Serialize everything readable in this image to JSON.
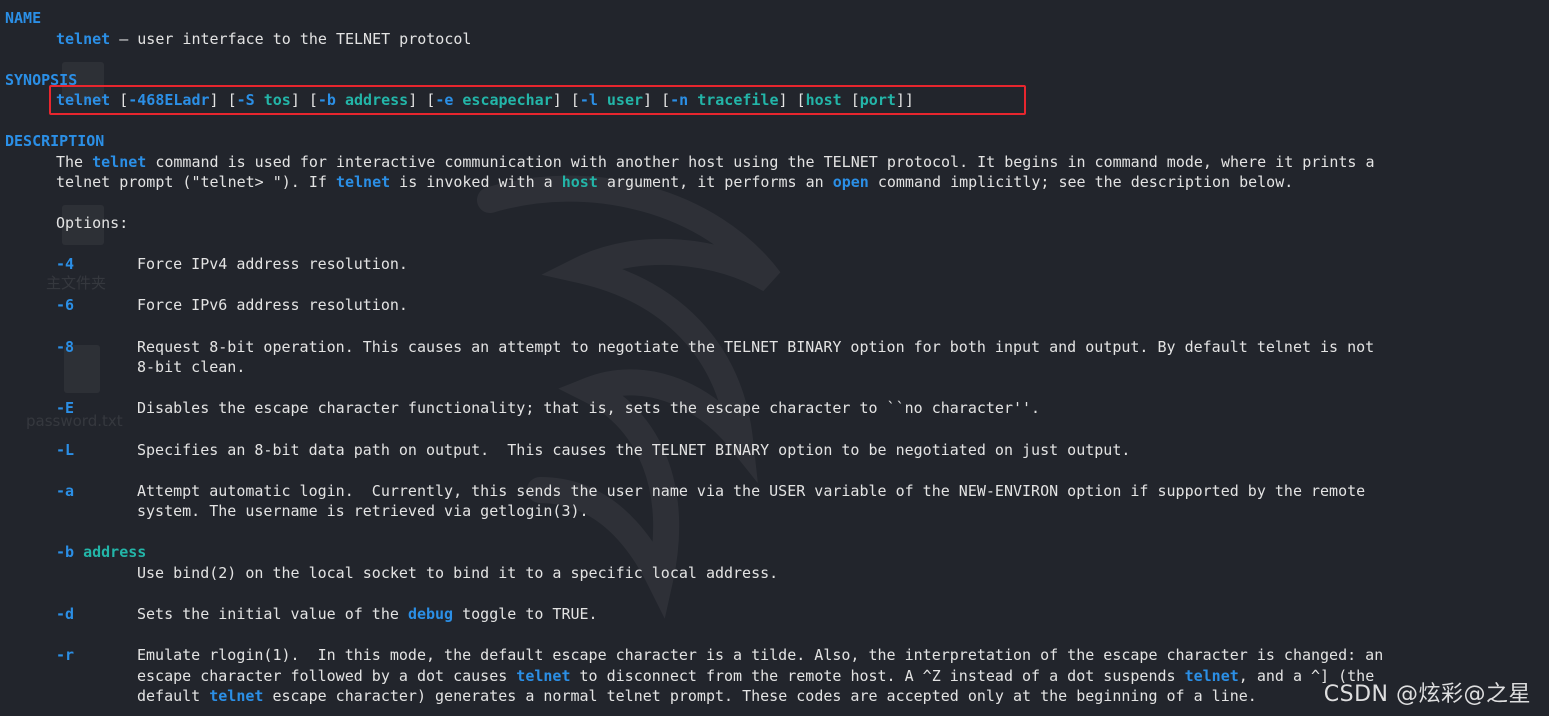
{
  "sections": {
    "name_heading": "NAME",
    "synopsis_heading": "SYNOPSIS",
    "description_heading": "DESCRIPTION"
  },
  "name": {
    "cmd": "telnet",
    "rest": " — user interface to the TELNET protocol"
  },
  "synopsis": {
    "p1": "telnet",
    "p2": " [",
    "p3": "-468ELadr",
    "p4": "] [",
    "p5": "-S",
    "p6": " ",
    "p7": "tos",
    "p8": "] [",
    "p9": "-b",
    "p10": " ",
    "p11": "address",
    "p12": "] [",
    "p13": "-e",
    "p14": " ",
    "p15": "escapechar",
    "p16": "] [",
    "p17": "-l",
    "p18": " ",
    "p19": "user",
    "p20": "] [",
    "p21": "-n",
    "p22": " ",
    "p23": "tracefile",
    "p24": "] [",
    "p25": "host",
    "p26": " [",
    "p27": "port",
    "p28": "]]"
  },
  "description": {
    "l1a": "The ",
    "l1b": "telnet",
    "l1c": " command is used for interactive communication with another host using the TELNET protocol. It begins in command mode, where it prints a",
    "l2a": "telnet prompt (\"telnet> \"). If ",
    "l2b": "telnet",
    "l2c": " is invoked with a ",
    "l2d": "host",
    "l2e": " argument, it performs an ",
    "l2f": "open",
    "l2g": " command implicitly; see the description below.",
    "options_label": "Options:"
  },
  "options": [
    {
      "flag": "-4",
      "text": "Force IPv4 address resolution."
    },
    {
      "flag": "-6",
      "text": "Force IPv6 address resolution."
    },
    {
      "flag": "-8",
      "text": "Request 8-bit operation. This causes an attempt to negotiate the TELNET BINARY option for both input and output. By default telnet is not",
      "text2": "8-bit clean."
    },
    {
      "flag": "-E",
      "text": "Disables the escape character functionality; that is, sets the escape character to ``no character''."
    },
    {
      "flag": "-L",
      "text": "Specifies an 8-bit data path on output.  This causes the TELNET BINARY option to be negotiated on just output."
    },
    {
      "flag": "-a",
      "text": "Attempt automatic login.  Currently, this sends the user name via the USER variable of the NEW-ENVIRON option if supported by the remote",
      "text2": "system. The username is retrieved via getlogin(3)."
    },
    {
      "flag": "-b",
      "arg": "address",
      "text": "Use bind(2) on the local socket to bind it to a specific local address."
    },
    {
      "flag": "-d",
      "text_a": "Sets the initial value of the ",
      "text_b": "debug",
      "text_c": " toggle to TRUE."
    },
    {
      "flag": "-r",
      "text": "Emulate rlogin(1).  In this mode, the default escape character is a tilde. Also, the interpretation of the escape character is changed: an",
      "text2a": "escape character followed by a dot causes ",
      "text2b": "telnet",
      "text2c": " to disconnect from the remote host. A ^Z instead of a dot suspends ",
      "text2d": "telnet",
      "text2e": ", and a ^] (the",
      "text3a": "default ",
      "text3b": "telnet",
      "text3c": " escape character) generates a normal telnet prompt. These codes are accepted only at the beginning of a line."
    }
  ],
  "desktop": {
    "icon_label_1": "主文件夹",
    "icon_label_2": "password.txt"
  },
  "watermark": "CSDN @炫彩@之星",
  "colors": {
    "background": "#22252c",
    "heading": "#2b8fe6",
    "argument": "#23b5a8",
    "highlight_box": "#e8262e"
  }
}
